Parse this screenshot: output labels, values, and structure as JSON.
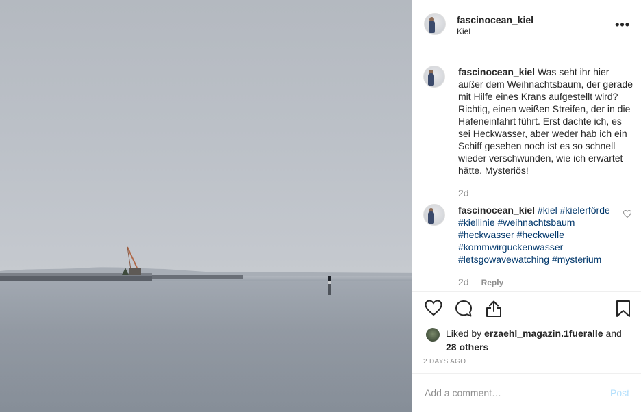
{
  "post_image": {
    "alt": ""
  },
  "header": {
    "username": "fascinocean_kiel",
    "location": "Kiel",
    "more_icon": "more-options-icon"
  },
  "caption": {
    "username": "fascinocean_kiel",
    "text": "Was seht ihr hier außer dem Weihnachtsbaum, der gerade mit Hilfe eines Krans aufgestellt wird? Richtig, einen weißen Streifen, der in die Hafeneinfahrt führt. Erst dachte ich, es sei Heckwasser, aber weder hab ich ein Schiff gesehen noch ist es so schnell wieder verschwunden, wie ich erwartet hätte. Mysteriös!",
    "age": "2d"
  },
  "comment": {
    "username": "fascinocean_kiel",
    "hashtags": [
      "#kiel",
      "#kielerförde",
      "#kiellinie",
      "#weihnachtsbaum",
      "#heckwasser",
      "#heckwelle",
      "#kommwirguckenwasser",
      "#letsgowavewatching",
      "#mysterium"
    ],
    "age": "2d",
    "reply_label": "Reply"
  },
  "actions": {
    "icons": [
      "heart-icon",
      "comment-icon",
      "share-icon",
      "bookmark-icon"
    ]
  },
  "likes": {
    "prefix": "Liked by",
    "user": "erzaehl_magazin.1fueralle",
    "conjunction": "and",
    "others": "28 others"
  },
  "timestamp": "2 DAYS AGO",
  "add_comment": {
    "placeholder": "Add a comment…",
    "post_label": "Post"
  },
  "colors": {
    "link": "#00376b",
    "muted": "#8e8e8e",
    "post_disabled": "#b2dffc"
  }
}
